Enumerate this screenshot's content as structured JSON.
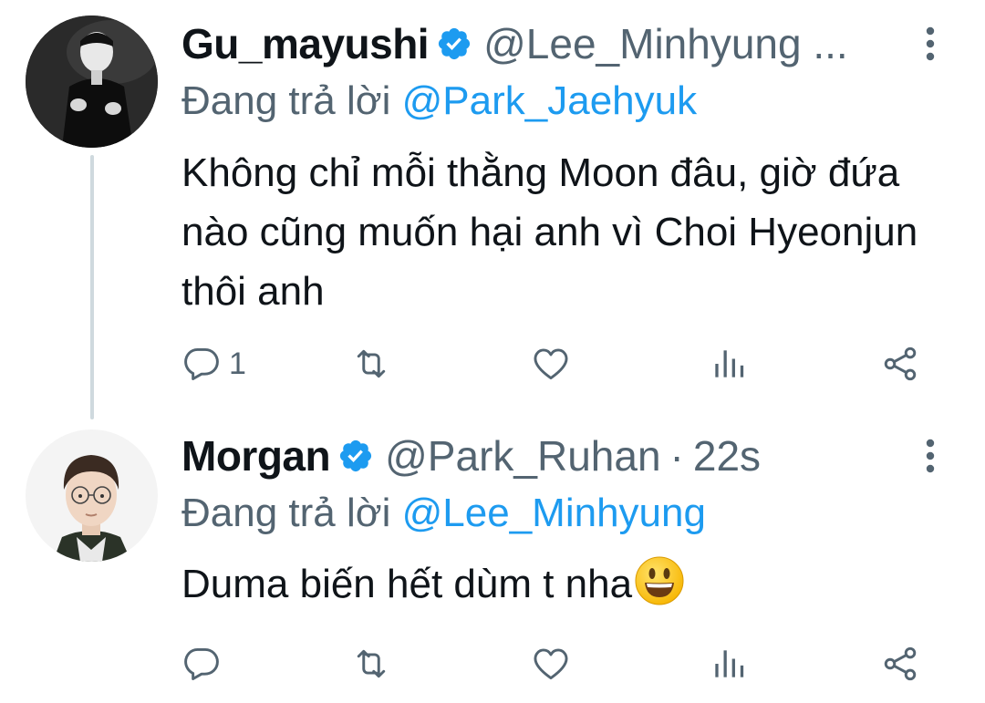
{
  "tweets": [
    {
      "display_name": "Gu_mayushi",
      "handle": "@Lee_Minhyung ...",
      "timestamp": "",
      "verified": true,
      "avatar": "avatar-photo",
      "reply_prefix": "Đang trả lời",
      "reply_to": "@Park_Jaehyuk",
      "text": "Không chỉ mỗi thằng Moon đâu, giờ đứa nào cũng muốn hại anh vì Choi Hyeonjun thôi anh",
      "reply_count": "1",
      "icons": [
        "reply-icon",
        "retweet-icon",
        "like-icon",
        "views-icon",
        "share-icon"
      ]
    },
    {
      "display_name": "Morgan",
      "handle": "@Park_Ruhan",
      "separator": "·",
      "timestamp": "22s",
      "verified": true,
      "avatar": "avatar-photo",
      "reply_prefix": "Đang trả lời",
      "reply_to": "@Lee_Minhyung",
      "text": "Duma biến hết dùm t nha",
      "emoji": "smiling-face-emoji",
      "reply_count": "",
      "icons": [
        "reply-icon",
        "retweet-icon",
        "like-icon",
        "views-icon",
        "share-icon"
      ]
    }
  ],
  "colors": {
    "text": "#0f1419",
    "secondary": "#536471",
    "accent": "#1d9bf0",
    "thread_line": "#cfd9de"
  }
}
